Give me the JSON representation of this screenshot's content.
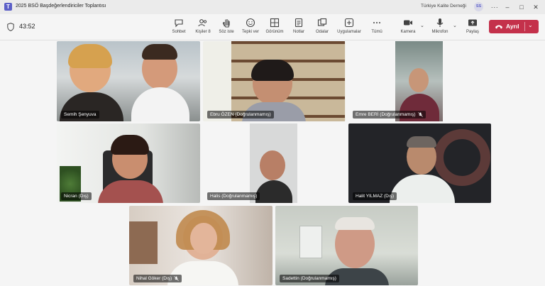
{
  "window": {
    "title": "2025 BSÖ Başdeğerlendiriciler Toplantısı",
    "org": "Türkiye Kalite Derneği",
    "user_initials": "SS",
    "logo_letter": "T"
  },
  "toolbar": {
    "timer": "43:52",
    "tools": [
      {
        "label": "Sohbet",
        "icon": "chat-icon"
      },
      {
        "label": "Kişiler",
        "icon": "people-icon",
        "badge": "8"
      },
      {
        "label": "Söz iste",
        "icon": "raise-hand-icon"
      },
      {
        "label": "Tepki ver",
        "icon": "react-icon"
      },
      {
        "label": "Görünüm",
        "icon": "view-icon"
      },
      {
        "label": "Notlar",
        "icon": "notes-icon"
      },
      {
        "label": "Odalar",
        "icon": "rooms-icon"
      },
      {
        "label": "Uygulamalar",
        "icon": "apps-icon"
      },
      {
        "label": "Tümü",
        "icon": "more-icon"
      },
      {
        "label": "Kamera",
        "icon": "camera-icon"
      },
      {
        "label": "Mikrofon",
        "icon": "microphone-icon"
      },
      {
        "label": "Paylaş",
        "icon": "share-icon"
      }
    ],
    "leave_label": "Ayrıl"
  },
  "participants": [
    {
      "name": "Semih Şenyuva",
      "muted": false
    },
    {
      "name": "Ebru ÖZEN (Doğrulanmamış)",
      "muted": false
    },
    {
      "name": "Emre BERİ (Doğrulanmamış)",
      "muted": true
    },
    {
      "name": "Nicran (Dış)",
      "muted": false
    },
    {
      "name": "Halis (Doğrulanmamış)",
      "muted": false
    },
    {
      "name": "Halit YILMAZ (Dış)",
      "muted": false
    },
    {
      "name": "Nihal Göker (Dış)",
      "muted": true
    },
    {
      "name": "Sadettin (Doğrulanmamış)",
      "muted": false
    }
  ]
}
